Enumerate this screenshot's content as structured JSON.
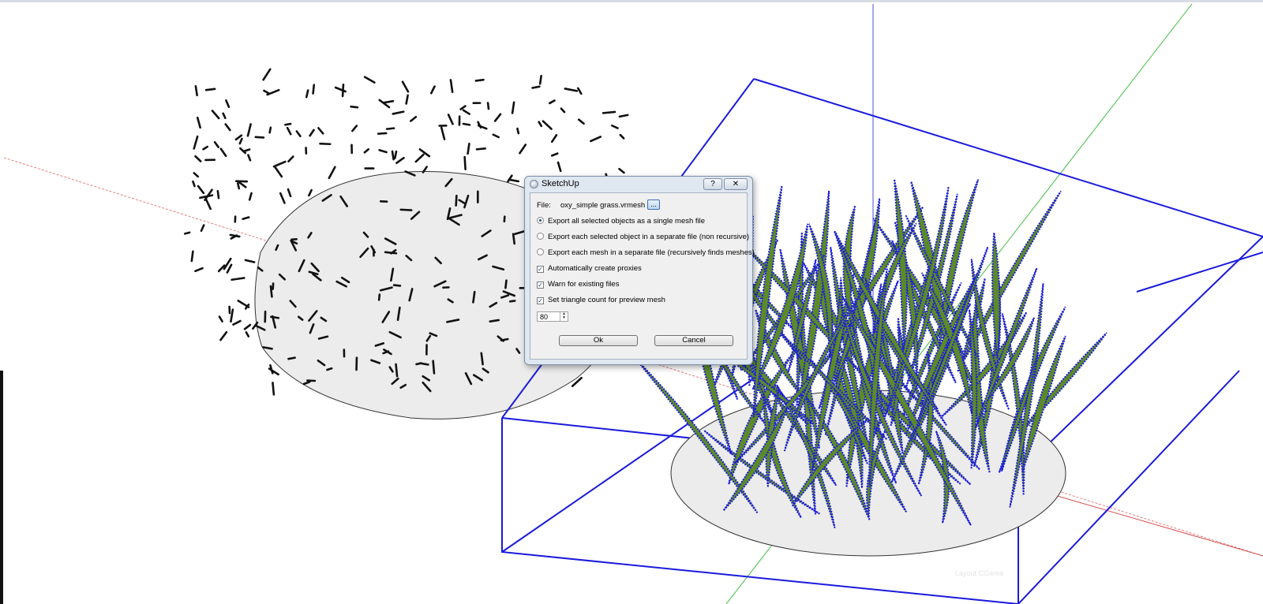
{
  "dialog": {
    "title": "SketchUp",
    "help_label": "?",
    "close_label": "✕",
    "file_label": "File:",
    "file_value": "oxy_simple grass.vrmesh",
    "browse_label": "...",
    "options": [
      {
        "label": "Export all selected objects as a single mesh file",
        "selected": true
      },
      {
        "label": "Export each selected object in a separate file (non recursive)",
        "selected": false
      },
      {
        "label": "Export each mesh in a separate file (recursively finds meshes)",
        "selected": false
      }
    ],
    "checkboxes": [
      {
        "label": "Automatically create proxies",
        "checked": true
      },
      {
        "label": "Warn for existing files",
        "checked": true
      },
      {
        "label": "Set triangle count for preview mesh",
        "checked": true
      }
    ],
    "triangle_count": "80",
    "ok_label": "Ok",
    "cancel_label": "Cancel"
  },
  "viewport": {
    "watermark": "Layout CGarea",
    "colors": {
      "selection": "#1a1adc",
      "grass": "#5c8a2a",
      "axis_red": "#e06060",
      "axis_green": "#2fb82f",
      "axis_blue": "#3a3ae0",
      "ground": "#ececec"
    }
  }
}
